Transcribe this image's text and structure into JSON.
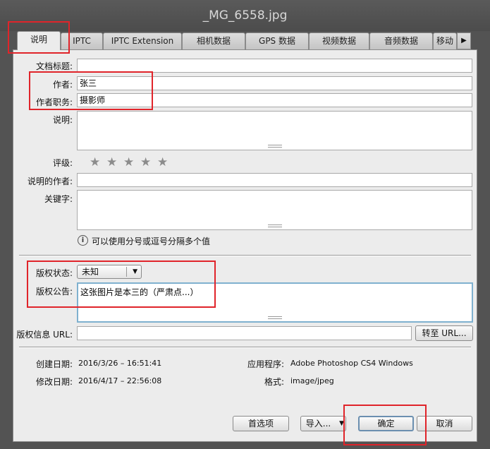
{
  "window": {
    "title": "_MG_6558.jpg"
  },
  "tabs": [
    {
      "label": "说明",
      "active": true
    },
    {
      "label": "IPTC"
    },
    {
      "label": "IPTC Extension"
    },
    {
      "label": "相机数据"
    },
    {
      "label": "GPS 数据"
    },
    {
      "label": "视频数据"
    },
    {
      "label": "音频数据"
    },
    {
      "label": "移动"
    }
  ],
  "form": {
    "doc_title": {
      "label": "文档标题:",
      "value": ""
    },
    "author": {
      "label": "作者:",
      "value": "张三"
    },
    "author_title": {
      "label": "作者职务:",
      "value": "摄影师"
    },
    "description": {
      "label": "说明:",
      "value": ""
    },
    "rating": {
      "label": "评级:",
      "stars": 5,
      "filled": 0
    },
    "desc_writer": {
      "label": "说明的作者:",
      "value": ""
    },
    "keywords": {
      "label": "关键字:",
      "value": ""
    },
    "hint": "可以使用分号或逗号分隔多个值",
    "copyright_status": {
      "label": "版权状态:",
      "value": "未知"
    },
    "copyright_notice": {
      "label": "版权公告:",
      "value": "这张图片是本三的（严肃点...）"
    },
    "copyright_url": {
      "label": "版权信息 URL:",
      "value": "",
      "goto_label": "转至 URL..."
    }
  },
  "meta": {
    "created": {
      "label": "创建日期:",
      "value": "2016/3/26 – 16:51:41"
    },
    "modified": {
      "label": "修改日期:",
      "value": "2016/4/17 – 22:56:08"
    },
    "app": {
      "label": "应用程序:",
      "value": "Adobe Photoshop CS4 Windows"
    },
    "format": {
      "label": "格式:",
      "value": "image/jpeg"
    }
  },
  "buttons": {
    "prefs": "首选项",
    "import": "导入...",
    "ok": "确定",
    "cancel": "取消"
  },
  "icons": {
    "star": "star-icon",
    "info": "info-icon",
    "dropdown": "chevron-down-icon",
    "tab_next": "chevron-right-icon"
  },
  "colors": {
    "highlight": "#e0242a",
    "focus_border": "#7fb1cf",
    "panel_bg": "#ececec"
  }
}
